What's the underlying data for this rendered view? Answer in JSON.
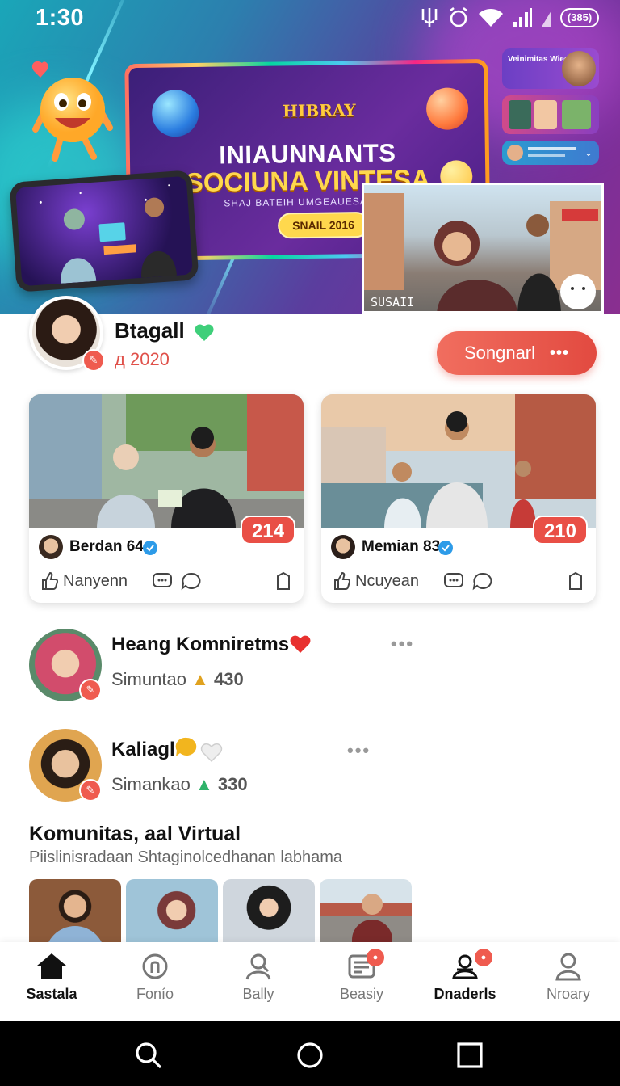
{
  "status_bar": {
    "time": "1:30",
    "battery": "(385)"
  },
  "hero": {
    "billboard_logo": "HIBRAY",
    "billboard_title": "INIAUNNANTS",
    "billboard_subtitle": "SOCIUNA VINTESA",
    "billboard_tagline": "SHAJ BATEIH UMGEAUESA BUS",
    "billboard_button": "SNAIL 2016",
    "street_caption": "SUSAII",
    "mini_card_1": "Veinimitas Wiedov"
  },
  "profile": {
    "name": "Btagall",
    "stat": "2020",
    "follow_label": "Songnarl",
    "follow_more": "•••"
  },
  "posts": [
    {
      "author": "Berdan 64",
      "count": "214",
      "reaction": "Nanyenn"
    },
    {
      "author": "Memian 83",
      "count": "210",
      "reaction": "Ncuyean"
    }
  ],
  "comments": [
    {
      "name": "Heang Komniretms",
      "sub": "Simuntao",
      "score": "430",
      "more": "•••"
    },
    {
      "name": "Kaliagl",
      "sub": "Simankao",
      "score": "330",
      "more": "•••"
    }
  ],
  "community": {
    "title": "Komunitas, aal Virtual",
    "subtitle": "Piislinisradaan Shtaginolcedhanan labhama"
  },
  "bottom_nav": [
    {
      "label": "Sastala",
      "icon": "home-icon"
    },
    {
      "label": "Fonío",
      "icon": "chat-icon"
    },
    {
      "label": "Bally",
      "icon": "person-icon"
    },
    {
      "label": "Beasiy",
      "icon": "news-icon"
    },
    {
      "label": "Dnaderls",
      "icon": "community-icon"
    },
    {
      "label": "Nroary",
      "icon": "profile-icon"
    }
  ],
  "colors": {
    "accent": "#e94f46",
    "verify_green": "#3fcf7a",
    "verify_blue": "#2d9be8"
  }
}
